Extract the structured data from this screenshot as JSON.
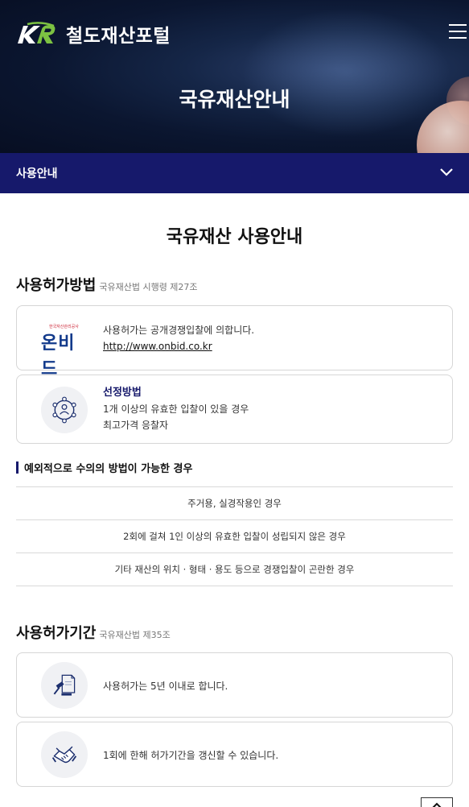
{
  "header": {
    "logo_text": "철도재산포털",
    "hero_title": "국유재산안내"
  },
  "subnav": {
    "label": "사용안내"
  },
  "page": {
    "title": "국유재산 사용안내"
  },
  "section1": {
    "heading": "사용허가방법",
    "subheading": "국유재산법 시행령 제27조",
    "card1": {
      "logo_small": "한국자산관리공사",
      "logo_big": "온비드",
      "line1": "사용허가는 공개경쟁입찰에 의합니다.",
      "link": "http://www.onbid.co.kr"
    },
    "card2": {
      "title": "선정방법",
      "line1": "1개 이상의 유효한 입찰이 있을 경우",
      "line2": "최고가격 응찰자"
    }
  },
  "exceptions": {
    "heading": "예외적으로 수의의 방법이 가능한 경우",
    "items": [
      "주거용, 실경작용인 경우",
      "2회에 걸쳐 1인 이상의 유효한 입찰이 성립되지 않은 경우",
      "기타 재산의 위치 · 형태 · 용도 등으로 경쟁입찰이 곤란한 경우"
    ]
  },
  "section2": {
    "heading": "사용허가기간",
    "subheading": "국유재산법 제35조",
    "card1": {
      "line1": "사용허가는 5년 이내로 합니다."
    },
    "card2": {
      "line1": "1회에 한해 허가기간을 갱신할 수 있습니다."
    }
  },
  "colors": {
    "navy": "#16196b",
    "brand_green": "#7cc242"
  }
}
